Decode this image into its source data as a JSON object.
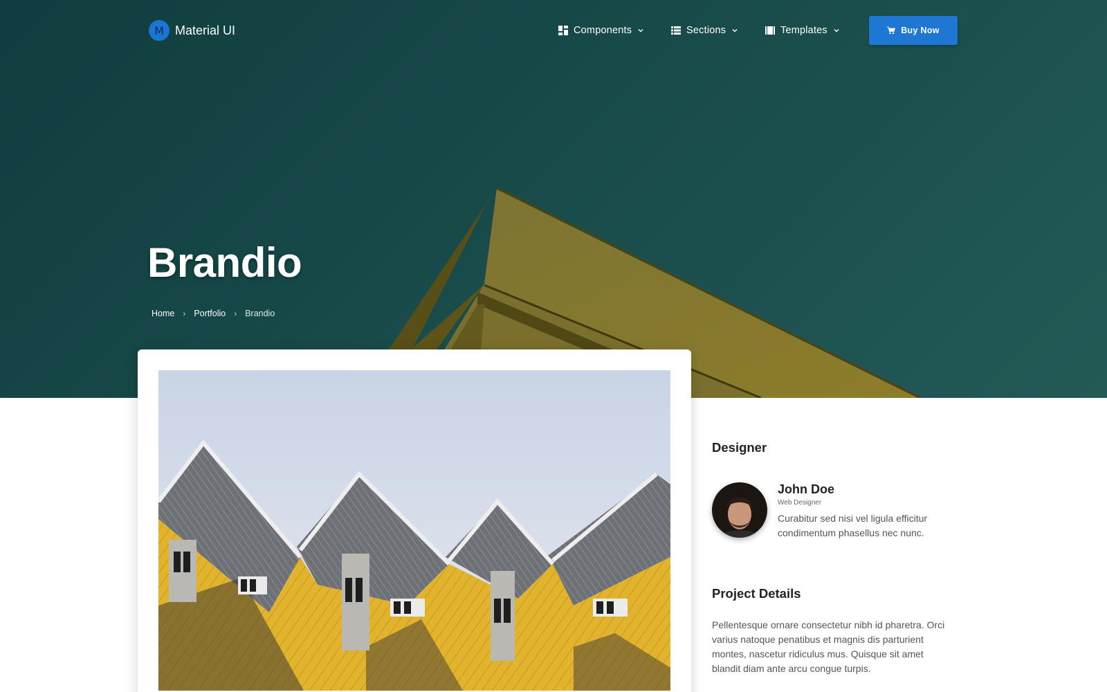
{
  "brand": {
    "logo_letter": "M",
    "name": "Material UI",
    "logo_color": "#1976d2"
  },
  "nav": {
    "items": [
      {
        "label": "Components",
        "icon": "dashboard-icon"
      },
      {
        "label": "Sections",
        "icon": "list-icon"
      },
      {
        "label": "Templates",
        "icon": "columns-icon"
      }
    ],
    "buy_label": "Buy Now",
    "buy_icon": "cart-icon",
    "buy_color": "#1e78d3"
  },
  "hero": {
    "title": "Brandio",
    "breadcrumb": [
      "Home",
      "Portfolio",
      "Brandio"
    ],
    "background": "#184a4a",
    "accent": "#8a7a2e"
  },
  "sidebar": {
    "designer_heading": "Designer",
    "designer": {
      "name": "John Doe",
      "role": "Web Designer",
      "bio": "Curabitur sed nisi vel ligula efficitur condimentum phasellus nec nunc."
    },
    "project_heading": "Project Details",
    "project_description": "Pellentesque ornare consectetur nibh id pharetra. Orci varius natoque penatibus et magnis dis parturient montes, nascetur ridiculus mus. Quisque sit amet blandit diam ante arcu congue turpis."
  }
}
